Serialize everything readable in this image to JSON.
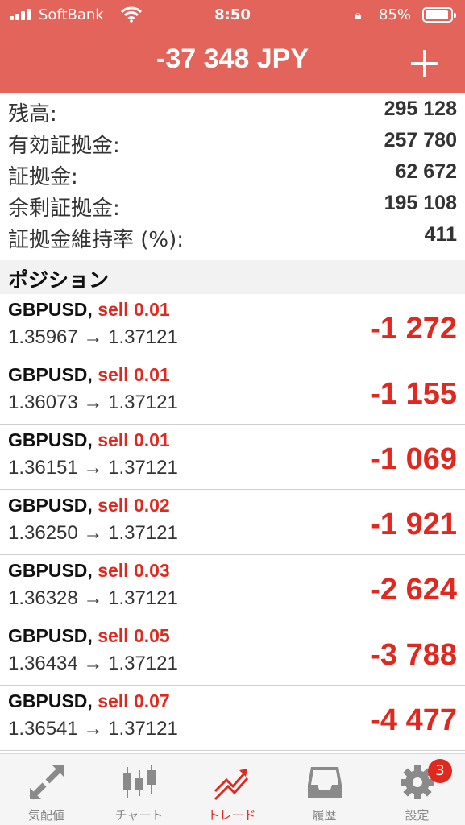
{
  "status_bar": {
    "carrier": "SoftBank",
    "time": "8:50",
    "battery": "85%"
  },
  "header": {
    "title": "-37 348 JPY",
    "accent_color": "#e2645a"
  },
  "summary": [
    {
      "label": "残高:",
      "value": "295 128"
    },
    {
      "label": "有効証拠金:",
      "value": "257 780"
    },
    {
      "label": "証拠金:",
      "value": "62 672"
    },
    {
      "label": "余剰証拠金:",
      "value": "195 108"
    },
    {
      "label": "証拠金維持率 (%):",
      "value": "411"
    }
  ],
  "positions_section": {
    "title": "ポジション",
    "items": [
      {
        "symbol": "GBPUSD,",
        "side": "sell 0.01",
        "prices": "1.35967 → 1.37121",
        "profit": "-1 272"
      },
      {
        "symbol": "GBPUSD,",
        "side": "sell 0.01",
        "prices": "1.36073 → 1.37121",
        "profit": "-1 155"
      },
      {
        "symbol": "GBPUSD,",
        "side": "sell 0.01",
        "prices": "1.36151 → 1.37121",
        "profit": "-1 069"
      },
      {
        "symbol": "GBPUSD,",
        "side": "sell 0.02",
        "prices": "1.36250 → 1.37121",
        "profit": "-1 921"
      },
      {
        "symbol": "GBPUSD,",
        "side": "sell 0.03",
        "prices": "1.36328 → 1.37121",
        "profit": "-2 624"
      },
      {
        "symbol": "GBPUSD,",
        "side": "sell 0.05",
        "prices": "1.36434 → 1.37121",
        "profit": "-3 788"
      },
      {
        "symbol": "GBPUSD,",
        "side": "sell 0.07",
        "prices": "1.36541 → 1.37121",
        "profit": "-4 477"
      }
    ]
  },
  "tabbar": {
    "tabs": [
      {
        "label": "気配値",
        "icon": "quotes-arrows-icon"
      },
      {
        "label": "チャート",
        "icon": "candlestick-icon"
      },
      {
        "label": "トレード",
        "icon": "trade-trend-icon",
        "active": true
      },
      {
        "label": "履歴",
        "icon": "inbox-history-icon"
      },
      {
        "label": "設定",
        "icon": "gear-icon"
      }
    ],
    "settings_badge": "3"
  }
}
